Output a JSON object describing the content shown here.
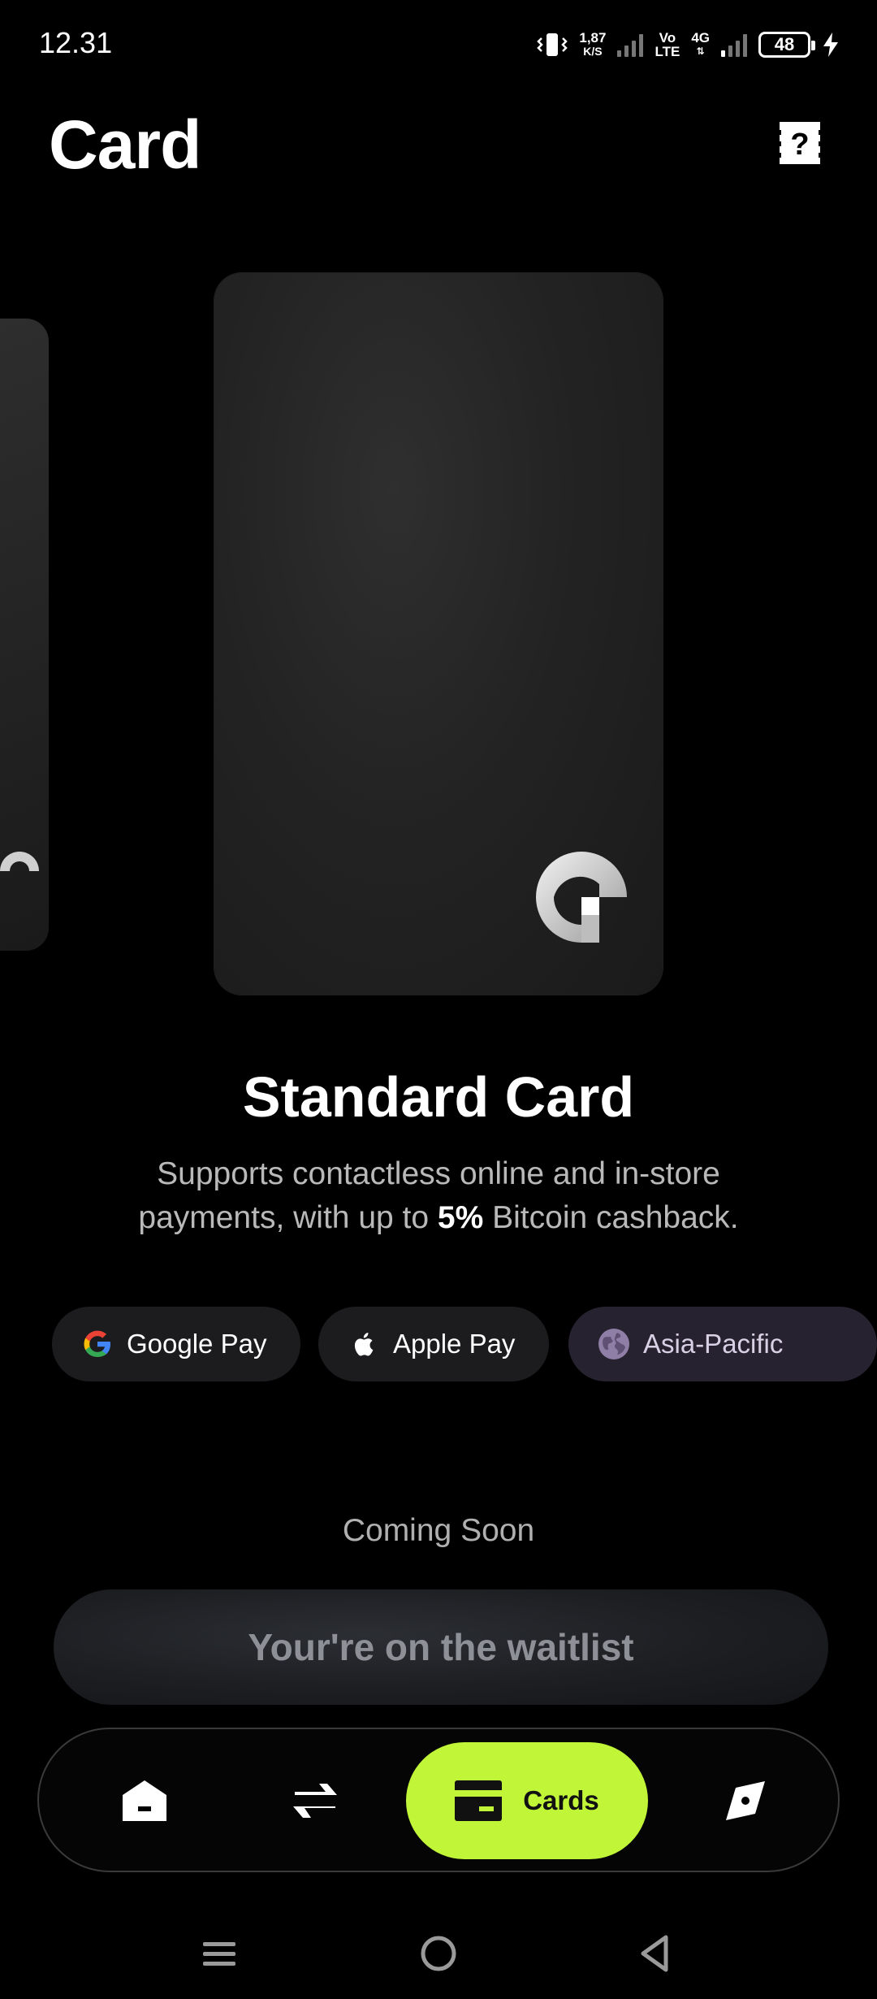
{
  "status_bar": {
    "time": "12.31",
    "net_speed_value": "1,87",
    "net_speed_unit": "K/S",
    "volte_top": "Vo",
    "volte_bottom": "LTE",
    "network_type": "4G",
    "battery_level": "48"
  },
  "header": {
    "title": "Card"
  },
  "card": {
    "name": "Standard Card",
    "description_before": "Supports contactless online and in-store payments, with up to ",
    "description_highlight": "5%",
    "description_after": " Bitcoin cashback."
  },
  "features": [
    {
      "label": "Google Pay",
      "icon": "google-icon"
    },
    {
      "label": "Apple Pay",
      "icon": "apple-icon"
    },
    {
      "label": "Asia-Pacific",
      "icon": "globe-icon"
    }
  ],
  "status_label": "Coming Soon",
  "waitlist_button": "Your're on the waitlist",
  "bottom_nav": {
    "items": [
      {
        "icon": "home-icon",
        "label": ""
      },
      {
        "icon": "transfer-icon",
        "label": ""
      },
      {
        "icon": "card-icon",
        "label": "Cards",
        "active": true
      },
      {
        "icon": "compass-icon",
        "label": ""
      }
    ]
  },
  "colors": {
    "accent": "#c1f538",
    "background": "#000000",
    "chip_background": "#1c1c1e",
    "region_chip_background": "#27222f"
  }
}
